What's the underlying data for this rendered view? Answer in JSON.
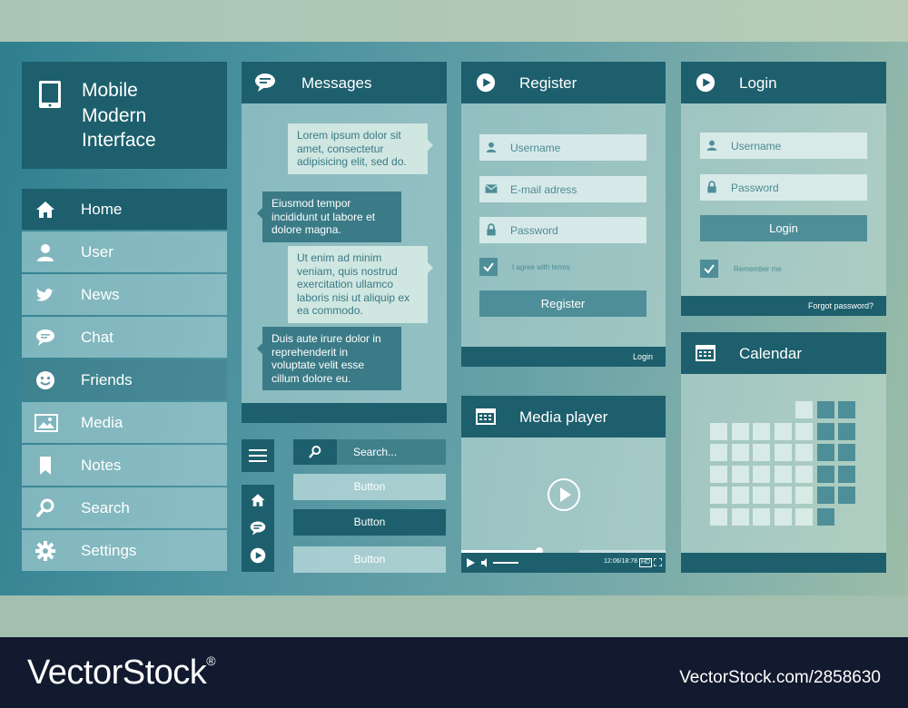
{
  "brand": {
    "title": "Mobile\nModern\nInterface"
  },
  "menu": {
    "items": [
      {
        "label": "Home",
        "icon": "home-icon"
      },
      {
        "label": "User",
        "icon": "user-icon"
      },
      {
        "label": "News",
        "icon": "bird-icon"
      },
      {
        "label": "Chat",
        "icon": "chat-icon"
      },
      {
        "label": "Friends",
        "icon": "smiley-icon"
      },
      {
        "label": "Media",
        "icon": "image-icon"
      },
      {
        "label": "Notes",
        "icon": "bookmark-icon"
      },
      {
        "label": "Search",
        "icon": "search-icon"
      },
      {
        "label": "Settings",
        "icon": "gear-icon"
      }
    ]
  },
  "messages": {
    "title": "Messages",
    "items": [
      "Lorem ipsum dolor sit amet, consectetur adipisicing elit, sed do.",
      "Eiusmod tempor incididunt ut labore et dolore magna.",
      "Ut enim ad minim veniam, quis nostrud exercitation ullamco laboris nisi ut aliquip ex ea commodo.",
      "Duis aute irure dolor in reprehenderit in voluptate velit esse cillum dolore eu."
    ]
  },
  "controls": {
    "search_placeholder": "Search...",
    "button1": "Button",
    "button2": "Button",
    "button3": "Button"
  },
  "register": {
    "title": "Register",
    "username": "Username",
    "email": "E-mail adress",
    "password": "Password",
    "terms": "I agree with terms",
    "button": "Register",
    "login_link": "Login"
  },
  "login": {
    "title": "Login",
    "username": "Username",
    "password": "Password",
    "button": "Login",
    "remember": "Remember me",
    "forgot": "Forgot password?"
  },
  "media": {
    "title": "Media player",
    "time": "12:06/18:78",
    "progress": 0.38
  },
  "calendar": {
    "title": "Calendar"
  },
  "footer": {
    "brand": "VectorStock",
    "image_id": "VectorStock.com/2858630"
  }
}
